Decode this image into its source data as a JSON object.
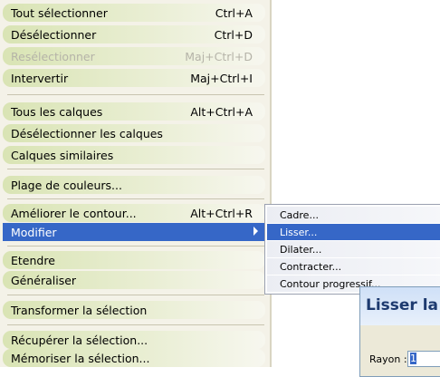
{
  "menu": {
    "items": [
      {
        "label": "Tout sélectionner",
        "shortcut": "Ctrl+A"
      },
      {
        "label": "Désélectionner",
        "shortcut": "Ctrl+D"
      },
      {
        "label": "Resélectionner",
        "shortcut": "Maj+Ctrl+D",
        "disabled": true
      },
      {
        "label": "Intervertir",
        "shortcut": "Maj+Ctrl+I"
      },
      {
        "label": "Tous les calques",
        "shortcut": "Alt+Ctrl+A"
      },
      {
        "label": "Désélectionner les calques",
        "shortcut": ""
      },
      {
        "label": "Calques similaires",
        "shortcut": ""
      },
      {
        "label": "Plage de couleurs...",
        "shortcut": ""
      },
      {
        "label": "Améliorer le contour...",
        "shortcut": "Alt+Ctrl+R"
      },
      {
        "label": "Modifier",
        "shortcut": "",
        "active": true,
        "submenu": true
      },
      {
        "label": "Etendre",
        "shortcut": ""
      },
      {
        "label": "Généraliser",
        "shortcut": ""
      },
      {
        "label": "Transformer la sélection",
        "shortcut": ""
      },
      {
        "label": "Récupérer la sélection...",
        "shortcut": ""
      },
      {
        "label": "Mémoriser la sélection...",
        "shortcut": ""
      }
    ]
  },
  "submenu": {
    "items": [
      {
        "label": "Cadre..."
      },
      {
        "label": "Lisser...",
        "active": true
      },
      {
        "label": "Dilater..."
      },
      {
        "label": "Contracter..."
      },
      {
        "label": "Contour progressif..."
      }
    ]
  },
  "dialog": {
    "title": "Lisser la",
    "rayon_label": "Rayon :",
    "rayon_value": "1"
  },
  "colors": {
    "menu_bg": "#f4f2e8",
    "item_gradient_start": "#d9e4b4",
    "highlight": "#3667c7",
    "disabled_text": "#b5b3a8"
  }
}
